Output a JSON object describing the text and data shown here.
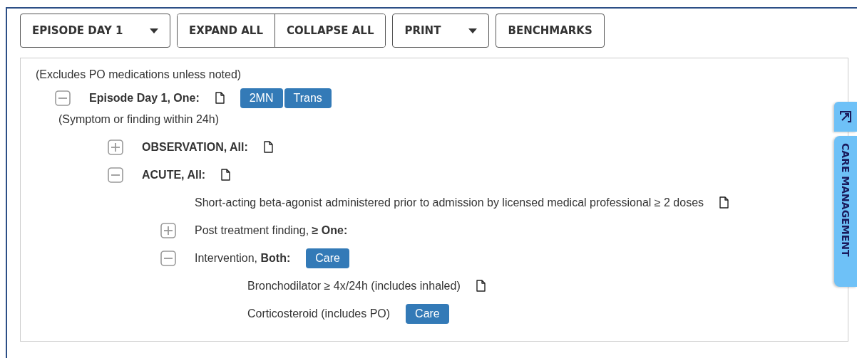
{
  "toolbar": {
    "episode_select": {
      "value": "EPISODE DAY 1"
    },
    "buttons": [
      {
        "label": "EXPAND ALL"
      },
      {
        "label": "COLLAPSE ALL"
      }
    ],
    "print_menu": {
      "label": "PRINT"
    },
    "benchmarks": {
      "label": "BENCHMARKS"
    }
  },
  "note": "(Excludes PO medications unless noted)",
  "tree": [
    {
      "label": "Episode Day 1, One:",
      "bold": true,
      "expanded": true,
      "has_doc": true,
      "tags": [
        "2MN",
        "Trans"
      ],
      "note": "(Symptom or finding within 24h)",
      "children": [
        {
          "label": "OBSERVATION, All:",
          "bold": true,
          "expanded": false,
          "has_doc": true
        },
        {
          "label": "ACUTE, All:",
          "bold": true,
          "expanded": true,
          "has_doc": true,
          "children": [
            {
              "label": "Short-acting beta-agonist administered prior to admission by licensed medical professional ≥ 2 doses",
              "bold": false,
              "has_doc": true
            },
            {
              "label": "Post treatment finding, **≥ One:**",
              "bold": false,
              "expanded": false,
              "has_doc": false
            },
            {
              "label": "Intervention, **Both:**",
              "bold": false,
              "expanded": true,
              "has_doc": false,
              "tags": [
                "Care"
              ],
              "children": [
                {
                  "label": "Bronchodilator ≥ 4x/24h (includes inhaled)",
                  "bold": false,
                  "has_doc": true
                },
                {
                  "label": "Corticosteroid (includes PO)",
                  "bold": false,
                  "has_doc": false,
                  "tags": [
                    "Care"
                  ]
                }
              ]
            }
          ]
        }
      ]
    }
  ],
  "side_tab": {
    "label": "CARE MANAGEMENT"
  }
}
